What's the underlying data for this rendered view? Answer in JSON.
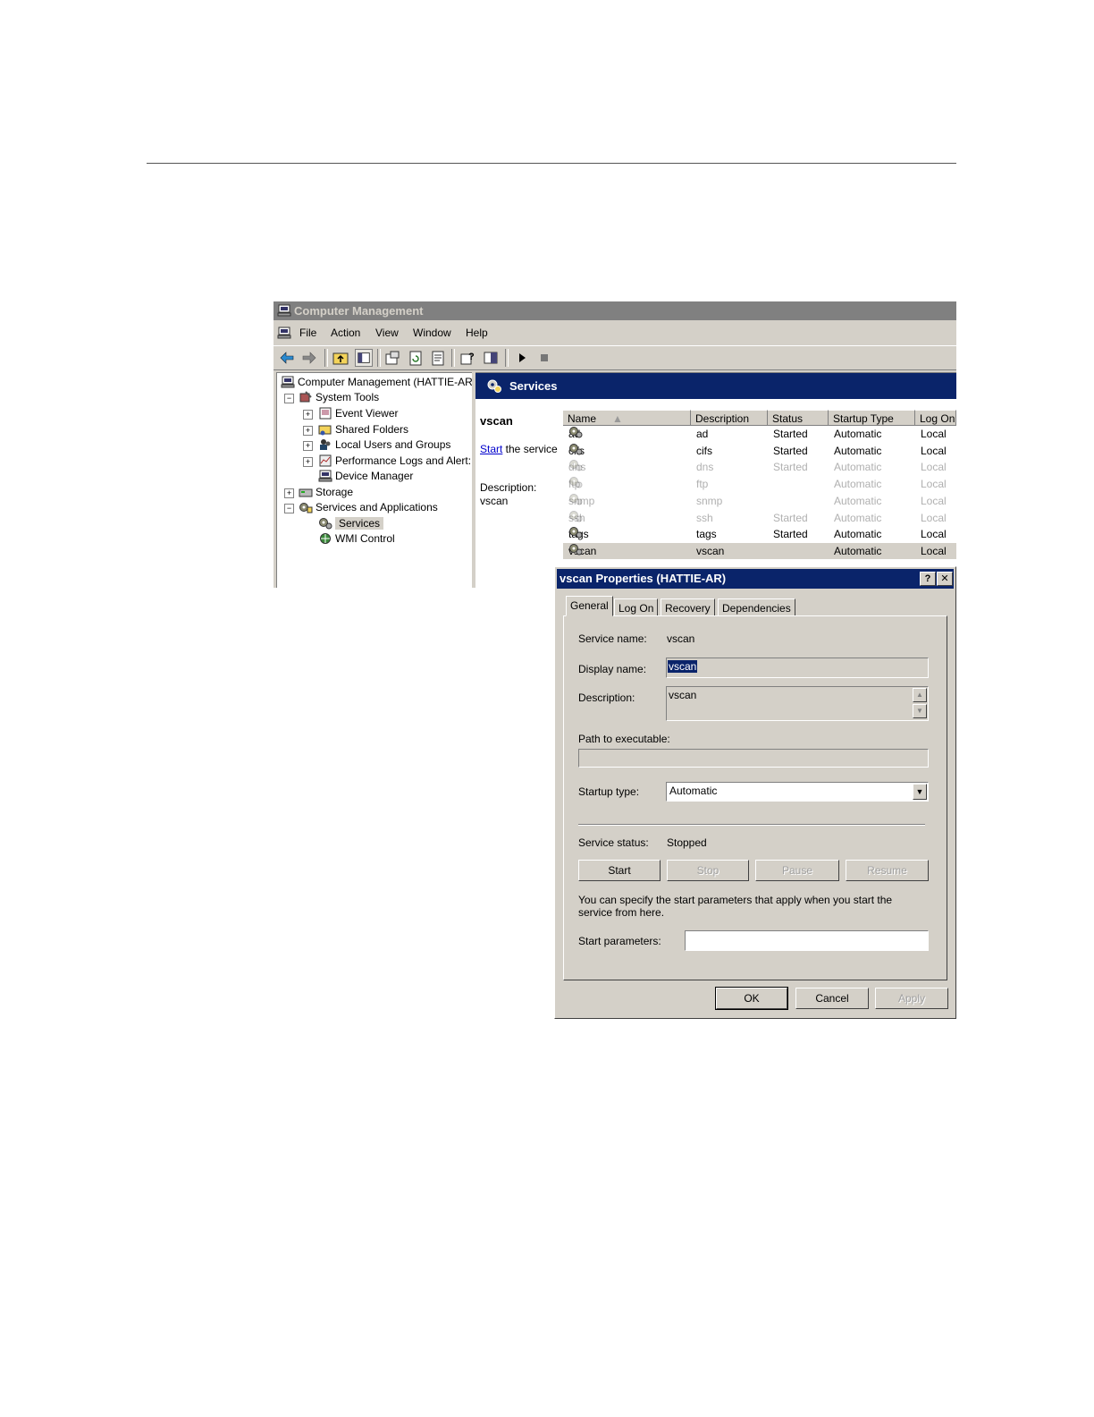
{
  "window": {
    "title": "Computer Management",
    "menu": [
      "File",
      "Action",
      "View",
      "Window",
      "Help"
    ]
  },
  "tree": {
    "root": "Computer Management (HATTIE-AR",
    "system_tools": "System Tools",
    "event_viewer": "Event Viewer",
    "shared_folders": "Shared Folders",
    "local_users": "Local Users and Groups",
    "perf_logs": "Performance Logs and Alert:",
    "device_manager": "Device Manager",
    "storage": "Storage",
    "services_apps": "Services and Applications",
    "services": "Services",
    "wmi": "WMI Control"
  },
  "right_pane": {
    "header": "Services",
    "selected_name": "vscan",
    "start_link": "Start",
    "start_rest": " the service",
    "desc_label": "Description:",
    "desc_value": "vscan"
  },
  "services_list": {
    "columns": [
      "Name",
      "Description",
      "Status",
      "Startup Type",
      "Log On"
    ],
    "rows": [
      {
        "name": "ad",
        "description": "ad",
        "status": "Started",
        "startup": "Automatic",
        "logon": "Local",
        "state": "normal"
      },
      {
        "name": "cifs",
        "description": "cifs",
        "status": "Started",
        "startup": "Automatic",
        "logon": "Local",
        "state": "normal"
      },
      {
        "name": "dns",
        "description": "dns",
        "status": "Started",
        "startup": "Automatic",
        "logon": "Local",
        "state": "dim"
      },
      {
        "name": "ftp",
        "description": "ftp",
        "status": "",
        "startup": "Automatic",
        "logon": "Local",
        "state": "dim"
      },
      {
        "name": "snmp",
        "description": "snmp",
        "status": "",
        "startup": "Automatic",
        "logon": "Local",
        "state": "dim"
      },
      {
        "name": "ssh",
        "description": "ssh",
        "status": "Started",
        "startup": "Automatic",
        "logon": "Local",
        "state": "dim"
      },
      {
        "name": "tags",
        "description": "tags",
        "status": "Started",
        "startup": "Automatic",
        "logon": "Local",
        "state": "normal"
      },
      {
        "name": "vscan",
        "description": "vscan",
        "status": "",
        "startup": "Automatic",
        "logon": "Local",
        "state": "selected"
      }
    ]
  },
  "dialog": {
    "title": "vscan Properties (HATTIE-AR)",
    "help_glyph": "?",
    "close_glyph": "✕",
    "tabs": [
      "General",
      "Log On",
      "Recovery",
      "Dependencies"
    ],
    "service_name_label": "Service name:",
    "service_name": "vscan",
    "display_name_label": "Display name:",
    "display_name": "vscan",
    "description_label": "Description:",
    "description": "vscan",
    "path_label": "Path to executable:",
    "path": "",
    "startup_type_label": "Startup type:",
    "startup_type": "Automatic",
    "status_label": "Service status:",
    "status": "Stopped",
    "buttons": {
      "start": "Start",
      "stop": "Stop",
      "pause": "Pause",
      "resume": "Resume"
    },
    "hint": "You can specify the start parameters that apply when you start the service from here.",
    "params_label": "Start parameters:",
    "params": "",
    "ok": "OK",
    "cancel": "Cancel",
    "apply": "Apply"
  }
}
